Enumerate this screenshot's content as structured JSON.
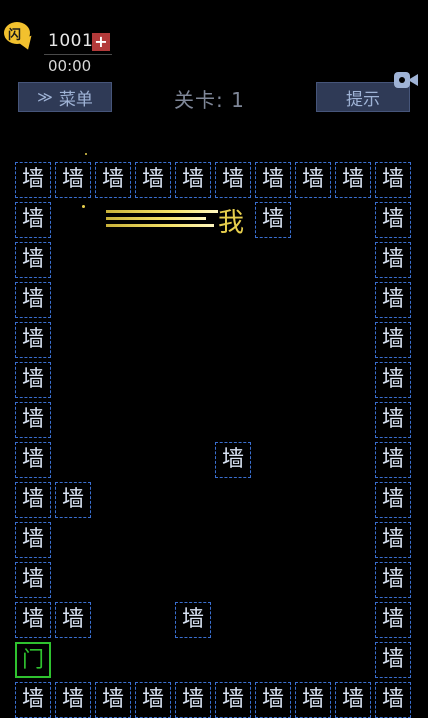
{
  "header": {
    "coin_badge_glyph": "闪",
    "coin_count": "1001",
    "coin_plus": "+",
    "timer": "00:00",
    "menu_chevron": "≫",
    "menu_label": "菜单",
    "level_label": "关卡: 1",
    "hint_label": "提示"
  },
  "board": {
    "wall_char": "墙",
    "door_char": "门",
    "player_char": "我"
  },
  "colors": {
    "wall_border": "#3a6fd0",
    "door": "#2fc22f",
    "player": "#e7cf4d",
    "button_bg": "#2f3a56"
  }
}
